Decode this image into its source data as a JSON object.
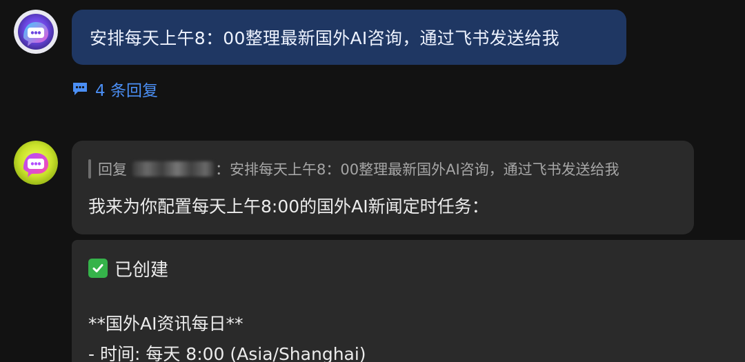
{
  "thread": {
    "user_message": {
      "text": "安排每天上午8：00整理最新国外AI咨询，通过飞书发送给我"
    },
    "replies": {
      "label": "4 条回复"
    },
    "bot_message": {
      "quote_prefix": "回复",
      "quote_separator": "：",
      "quote_text": "安排每天上午8：00整理最新国外AI咨询，通过飞书发送给我",
      "text": "我来为你配置每天上午8:00的国外AI新闻定时任务："
    },
    "detail": {
      "created_label": "已创建",
      "task_title": "**国外AI资讯每日**",
      "task_time": "- 时间: 每天 8:00 (Asia/Shanghai)"
    }
  },
  "icons": {
    "avatar_user": "chat-bubble-avatar-purple",
    "avatar_bot": "chat-bubble-avatar-lime",
    "replies_icon": "comment-icon",
    "created_icon": "check-icon"
  },
  "colors": {
    "background": "#121212",
    "user_bubble": "#1f3763",
    "bot_bubble": "#2a2a2a",
    "link": "#4b8ff5",
    "check": "#35b34a"
  }
}
